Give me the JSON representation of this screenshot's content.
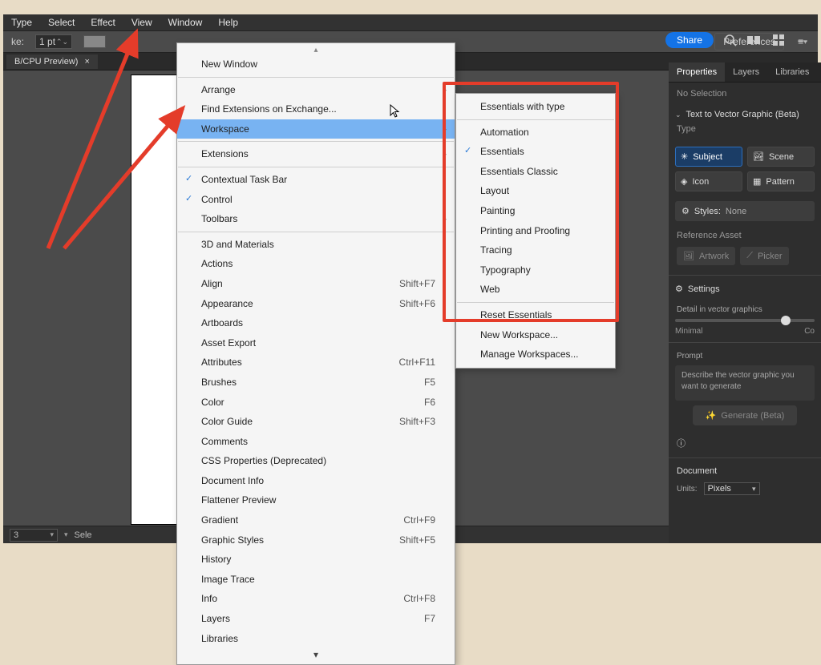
{
  "menubar": {
    "items": [
      "Type",
      "Select",
      "Effect",
      "View",
      "Window",
      "Help"
    ]
  },
  "controlbar": {
    "stroke_label": "ke:",
    "stroke_value": "1 pt",
    "preferences": "Preferences"
  },
  "tab": {
    "title": "B/CPU Preview)"
  },
  "share": "Share",
  "main_menu": {
    "items": [
      {
        "label": "New Window"
      },
      {
        "sep": true
      },
      {
        "label": "Arrange",
        "sub": true
      },
      {
        "label": "Find Extensions on Exchange..."
      },
      {
        "label": "Workspace",
        "sub": true,
        "hover": true
      },
      {
        "sep": true
      },
      {
        "label": "Extensions",
        "sub": true
      },
      {
        "sep": true
      },
      {
        "label": "Contextual Task Bar",
        "check": true
      },
      {
        "label": "Control",
        "check": true
      },
      {
        "label": "Toolbars",
        "sub": true
      },
      {
        "sep": true
      },
      {
        "label": "3D and Materials"
      },
      {
        "label": "Actions"
      },
      {
        "label": "Align",
        "shortcut": "Shift+F7"
      },
      {
        "label": "Appearance",
        "shortcut": "Shift+F6"
      },
      {
        "label": "Artboards"
      },
      {
        "label": "Asset Export"
      },
      {
        "label": "Attributes",
        "shortcut": "Ctrl+F11"
      },
      {
        "label": "Brushes",
        "shortcut": "F5"
      },
      {
        "label": "Color",
        "shortcut": "F6"
      },
      {
        "label": "Color Guide",
        "shortcut": "Shift+F3"
      },
      {
        "label": "Comments"
      },
      {
        "label": "CSS Properties (Deprecated)"
      },
      {
        "label": "Document Info"
      },
      {
        "label": "Flattener Preview"
      },
      {
        "label": "Gradient",
        "shortcut": "Ctrl+F9"
      },
      {
        "label": "Graphic Styles",
        "shortcut": "Shift+F5"
      },
      {
        "label": "History"
      },
      {
        "label": "Image Trace"
      },
      {
        "label": "Info",
        "shortcut": "Ctrl+F8"
      },
      {
        "label": "Layers",
        "shortcut": "F7"
      },
      {
        "label": "Libraries"
      }
    ]
  },
  "sub_menu": {
    "items": [
      {
        "label": "Essentials with type"
      },
      {
        "sep": true
      },
      {
        "label": "Automation"
      },
      {
        "label": "Essentials",
        "check": true
      },
      {
        "label": "Essentials Classic"
      },
      {
        "label": "Layout"
      },
      {
        "label": "Painting"
      },
      {
        "label": "Printing and Proofing"
      },
      {
        "label": "Tracing"
      },
      {
        "label": "Typography"
      },
      {
        "label": "Web"
      },
      {
        "sep": true
      },
      {
        "label": "Reset Essentials"
      },
      {
        "label": "New Workspace..."
      },
      {
        "label": "Manage Workspaces..."
      }
    ]
  },
  "rightpanel": {
    "tabs": [
      "Properties",
      "Layers",
      "Libraries"
    ],
    "no_selection": "No Selection",
    "ttv": "Text to Vector Graphic (Beta)",
    "type_label": "Type",
    "type_buttons": [
      "Subject",
      "Scene",
      "Icon",
      "Pattern"
    ],
    "styles_label": "Styles:",
    "styles_value": "None",
    "reference_label": "Reference Asset",
    "ref_buttons": [
      "Artwork",
      "Picker"
    ],
    "settings": "Settings",
    "detail_label": "Detail in vector graphics",
    "detail_min": "Minimal",
    "detail_max": "Co",
    "prompt_title": "Prompt",
    "prompt_placeholder": "Describe the vector graphic you want to generate",
    "generate": "Generate (Beta)",
    "document": "Document",
    "units_label": "Units:",
    "units_value": "Pixels"
  },
  "statusbar": {
    "zoom": "3",
    "tool": "Sele"
  },
  "annotation": {
    "redbox": true
  }
}
